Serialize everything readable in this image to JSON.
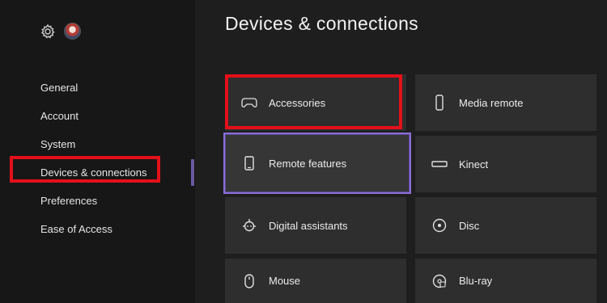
{
  "sidebar": {
    "items": [
      {
        "label": "General"
      },
      {
        "label": "Account"
      },
      {
        "label": "System"
      },
      {
        "label": "Devices & connections"
      },
      {
        "label": "Preferences"
      },
      {
        "label": "Ease of Access"
      }
    ],
    "selected": "Devices & connections"
  },
  "main": {
    "title": "Devices & connections",
    "tiles": [
      {
        "label": "Accessories",
        "icon": "gamepad-icon"
      },
      {
        "label": "Media remote",
        "icon": "remote-icon"
      },
      {
        "label": "Remote features",
        "icon": "phone-icon"
      },
      {
        "label": "Kinect",
        "icon": "kinect-icon"
      },
      {
        "label": "Digital assistants",
        "icon": "assistant-icon"
      },
      {
        "label": "Disc",
        "icon": "disc-icon"
      },
      {
        "label": "Mouse",
        "icon": "mouse-icon"
      },
      {
        "label": "Blu-ray",
        "icon": "bluray-icon"
      }
    ]
  },
  "colors": {
    "accent": "#8a6fd6",
    "highlight": "#e3101a",
    "tile_bg": "#2e2e2e",
    "sidebar_bg": "#171717"
  }
}
